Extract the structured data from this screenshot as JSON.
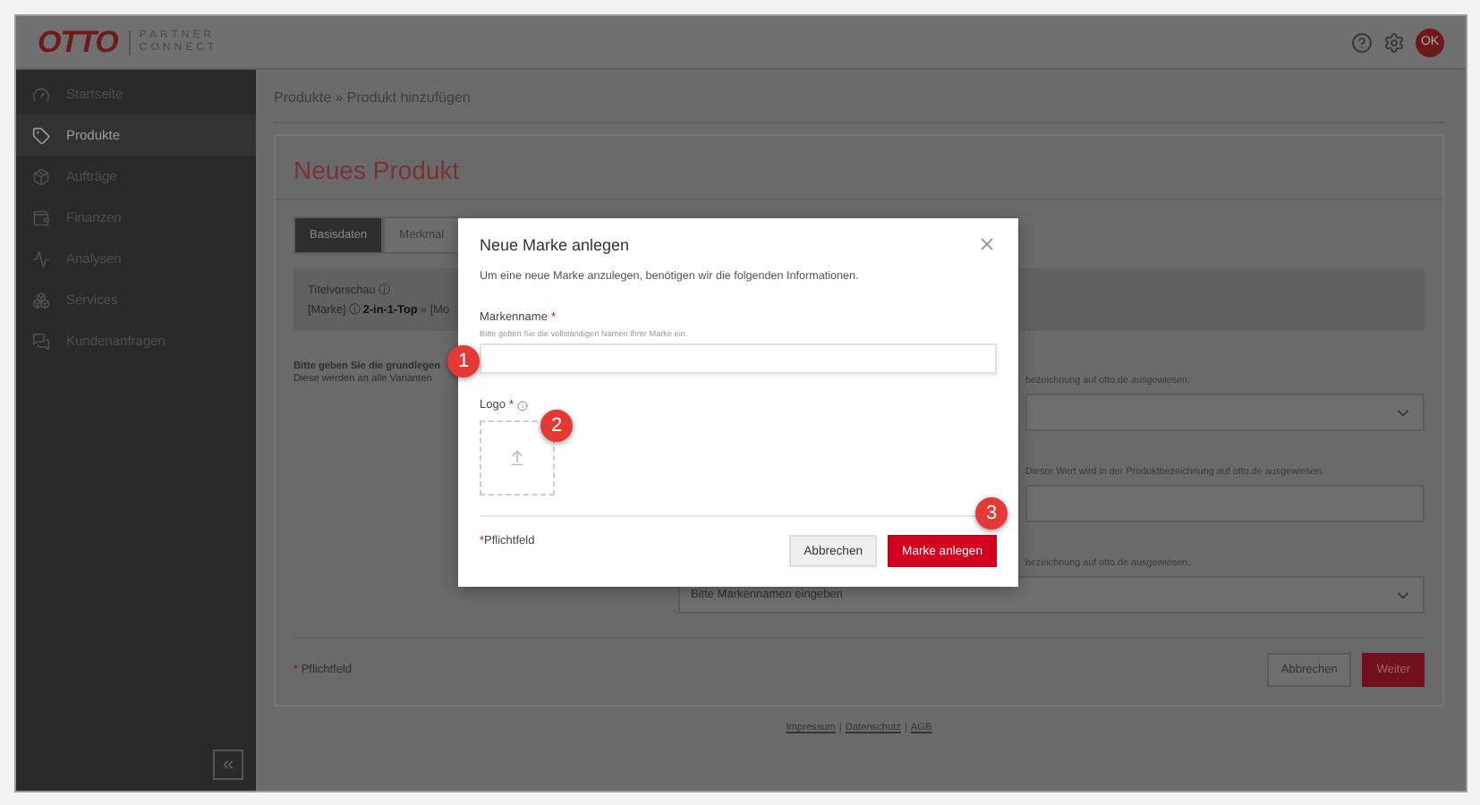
{
  "header": {
    "logo": "OTTO",
    "logo_sub": [
      "PARTNER",
      "CONNECT"
    ],
    "avatar": "OK"
  },
  "sidebar": {
    "items": [
      {
        "label": "Startseite",
        "selected": false
      },
      {
        "label": "Produkte",
        "selected": true
      },
      {
        "label": "Aufträge",
        "selected": false
      },
      {
        "label": "Finanzen",
        "selected": false
      },
      {
        "label": "Analysen",
        "selected": false
      },
      {
        "label": "Services",
        "selected": false
      },
      {
        "label": "Kundenanfragen",
        "selected": false
      }
    ]
  },
  "breadcrumb": "Produkte » Produkt hinzufügen",
  "card": {
    "title": "Neues Produkt",
    "tabs": [
      {
        "label": "Basisdaten",
        "selected": true
      },
      {
        "label": "Merkmal",
        "selected": false
      }
    ],
    "preview": {
      "title": "Titelvorschau ⓘ",
      "line": "[Marke] ⓘ **2-in-1-Top** » [Mo"
    },
    "intro": [
      "Bitte geben Sie die grundlegen",
      "Diese werden an alle Varianten"
    ],
    "fields": [
      {
        "kind": "select",
        "hint": "bezeichnung auf otto.de ausgewiesen."
      },
      {
        "kind": "input",
        "hint": "Dieser Wert wird in der Produktbezeichnung auf otto.de ausgewiesen."
      },
      {
        "kind": "select",
        "hint": "bezeichnung auf otto.de ausgewiesen.",
        "value": "Bitte Markennamen eingeben"
      }
    ],
    "required_note": {
      "mark": "*",
      "text": "Pflichtfeld"
    },
    "buttons": [
      {
        "label": "Abbrechen",
        "kind": "secondary"
      },
      {
        "label": "Weiter",
        "kind": "primary"
      }
    ]
  },
  "footer_links": {
    "links": [
      "Impressum",
      "Datenschutz",
      "AGB"
    ],
    "separator": "|"
  },
  "modal": {
    "title": "Neue Marke anlegen",
    "description": "Um eine neue Marke anzulegen, benötigen wir die folgenden Informationen.",
    "name_field": {
      "label": "Markenname",
      "required_mark": "*",
      "hint": "Bitte geben Sie die vollständigen Namen Ihrer Marke ein."
    },
    "logo_field": {
      "label": "Logo",
      "required_mark": "*"
    },
    "required_note": {
      "mark": "*",
      "text": "Pflichtfeld"
    },
    "buttons": [
      {
        "label": "Abbrechen",
        "kind": "secondary"
      },
      {
        "label": "Marke anlegen",
        "kind": "primary"
      }
    ],
    "badges": [
      "1",
      "2",
      "3"
    ]
  }
}
